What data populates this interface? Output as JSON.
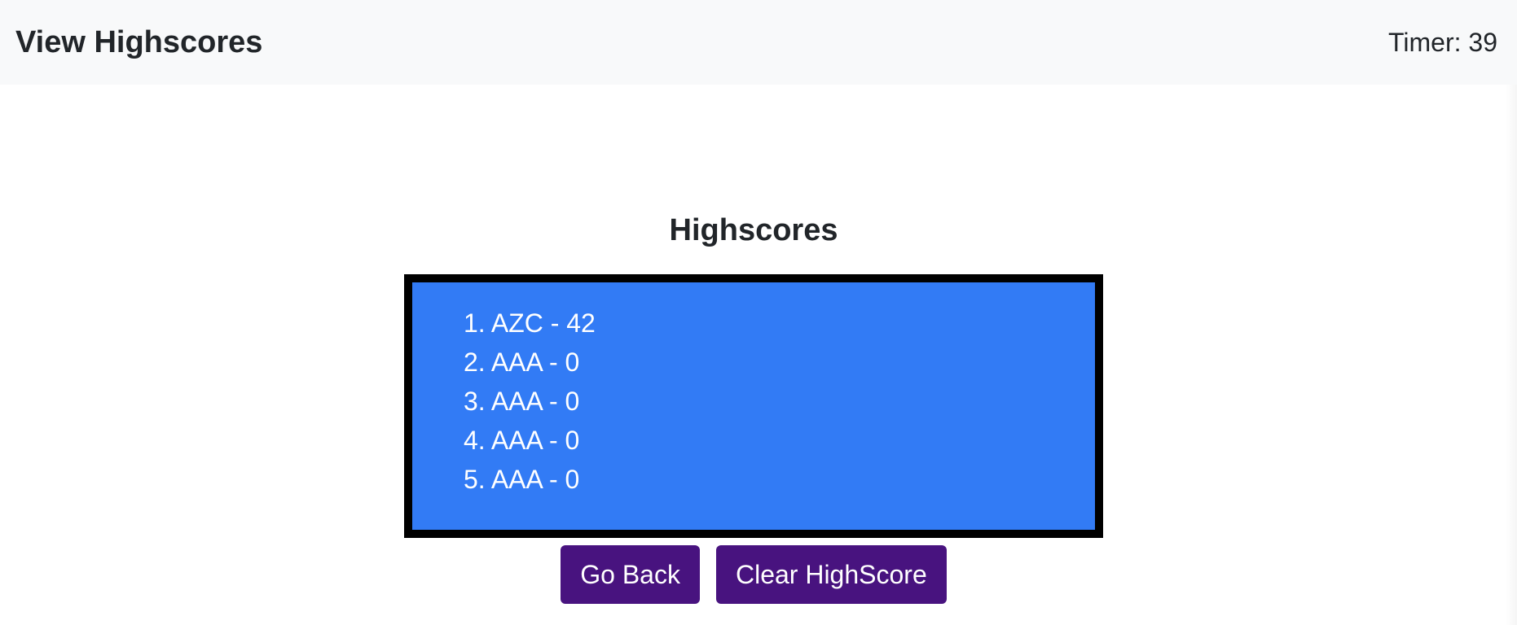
{
  "navbar": {
    "view_highscores_label": "View Highscores",
    "timer_text": "Timer: 39"
  },
  "highscores": {
    "title": "Highscores",
    "entries": [
      "1. AZC - 42",
      "2. AAA - 0",
      "3. AAA - 0",
      "4. AAA - 0",
      "5. AAA - 0"
    ]
  },
  "buttons": {
    "go_back_label": "Go Back",
    "clear_label": "Clear HighScore"
  },
  "colors": {
    "navbar_bg": "#f8f9fa",
    "score_box_bg": "#327bf5",
    "score_box_border": "#000000",
    "button_bg": "#48137f"
  }
}
